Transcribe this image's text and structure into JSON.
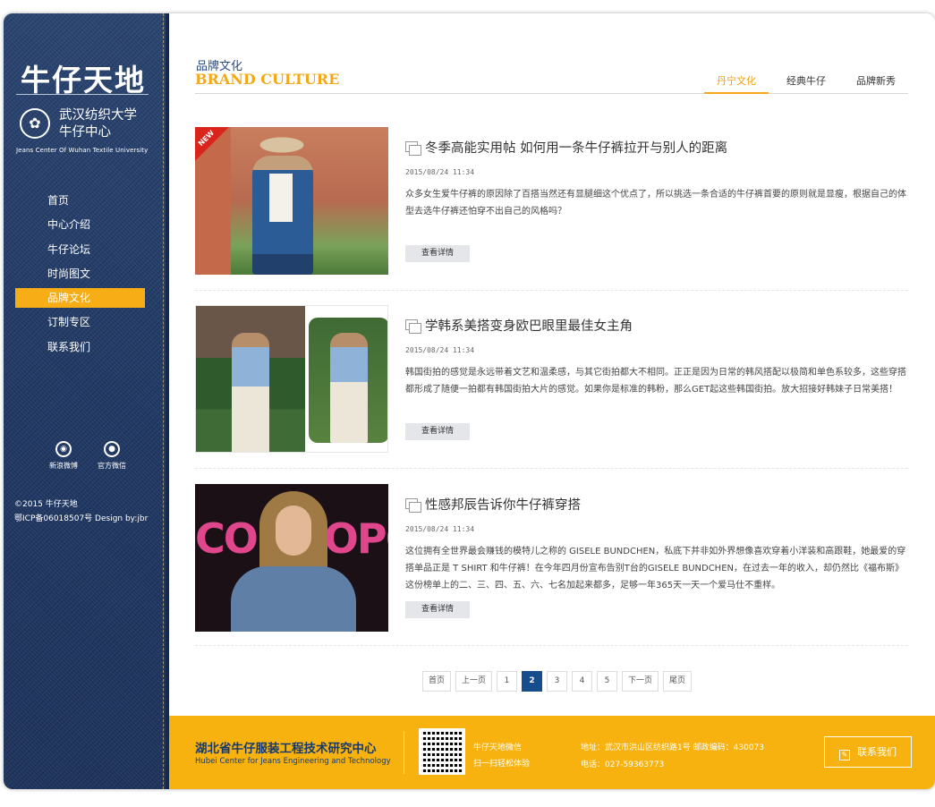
{
  "sidebar": {
    "logo": "牛仔天地",
    "emblem": "✿",
    "university_line1": "武汉纺织大学",
    "university_line2": "牛仔中心",
    "university_en": "Jeans Center Of Wuhan Textile University",
    "nav": [
      {
        "label": "首页"
      },
      {
        "label": "中心介绍"
      },
      {
        "label": "牛仔论坛"
      },
      {
        "label": "时尚图文"
      },
      {
        "label": "品牌文化",
        "active": true
      },
      {
        "label": "订制专区"
      },
      {
        "label": "联系我们"
      }
    ],
    "social": [
      {
        "label": "新浪微博",
        "icon": "weibo-icon"
      },
      {
        "label": "官方微信",
        "icon": "wechat-icon"
      }
    ],
    "copyright": "©2015 牛仔天地",
    "icp": "鄂ICP备06018507号 Design by:jbr"
  },
  "section": {
    "title_cn": "品牌文化",
    "title_en": "BRAND CULTURE",
    "tabs": [
      {
        "label": "丹宁文化",
        "active": true
      },
      {
        "label": "经典牛仔"
      },
      {
        "label": "品牌新秀"
      }
    ]
  },
  "articles": [
    {
      "badge": "NEW",
      "title": "冬季高能实用帖 如何用一条牛仔裤拉开与别人的距离",
      "date": "2015/08/24 11:34",
      "summary": "众多女生爱牛仔裤的原因除了百搭当然还有显腿细这个优点了，所以挑选一条合适的牛仔裤首要的原则就是显瘦，根据自己的体型去选牛仔裤还怕穿不出自己的风格吗？",
      "more": "查看详情"
    },
    {
      "title": "学韩系美搭变身欧巴眼里最佳女主角",
      "date": "2015/08/24 11:34",
      "summary": "韩国街拍的感觉是永远带着文艺和温柔感，与其它街拍都大不相同。正正是因为日常的韩风搭配以极简和单色系较多，这些穿搭都形成了随便一拍都有韩国街拍大片的感觉。如果你是标准的韩粉，那么GET起这些韩国街拍。放大招接好韩妹子日常美搭！",
      "more": "查看详情"
    },
    {
      "magazine": "COSMOPOLIT",
      "title": "性感邦辰告诉你牛仔裤穿搭",
      "date": "2015/08/24 11:34",
      "summary": "这位拥有全世界最会赚钱的模特儿之称的 GISELE BUNDCHEN，私底下并非如外界想像喜欢穿着小洋装和高跟鞋，她最爱的穿搭单品正是 T SHIRT 和牛仔裤！在今年四月份宣布告别T台的GISELE BUNDCHEN，在过去一年的收入，却仍然比《福布斯》这份榜单上的二、三、四、五、六、七名加起来都多，足够一年365天一天一个爱马仕不重样。",
      "more": "查看详情"
    }
  ],
  "pagination": [
    "首页",
    "上一页",
    "1",
    "2",
    "3",
    "4",
    "5",
    "下一页",
    "尾页"
  ],
  "pagination_current": "2",
  "footer": {
    "org_cn": "湖北省牛仔服装工程技术研究中心",
    "org_en": "Hubei Center for Jeans Engineering and Technology",
    "qr_label1": "牛仔天地微信",
    "qr_label2": "扫一扫轻松体验",
    "address": "地址：武汉市洪山区纺织路1号  邮政编码：430073",
    "phone": "电话：027-59363773",
    "contact_label": "联系我们"
  },
  "colors": {
    "accent": "#f6ad16",
    "navy": "#164d8c",
    "denim": "#223a66"
  }
}
